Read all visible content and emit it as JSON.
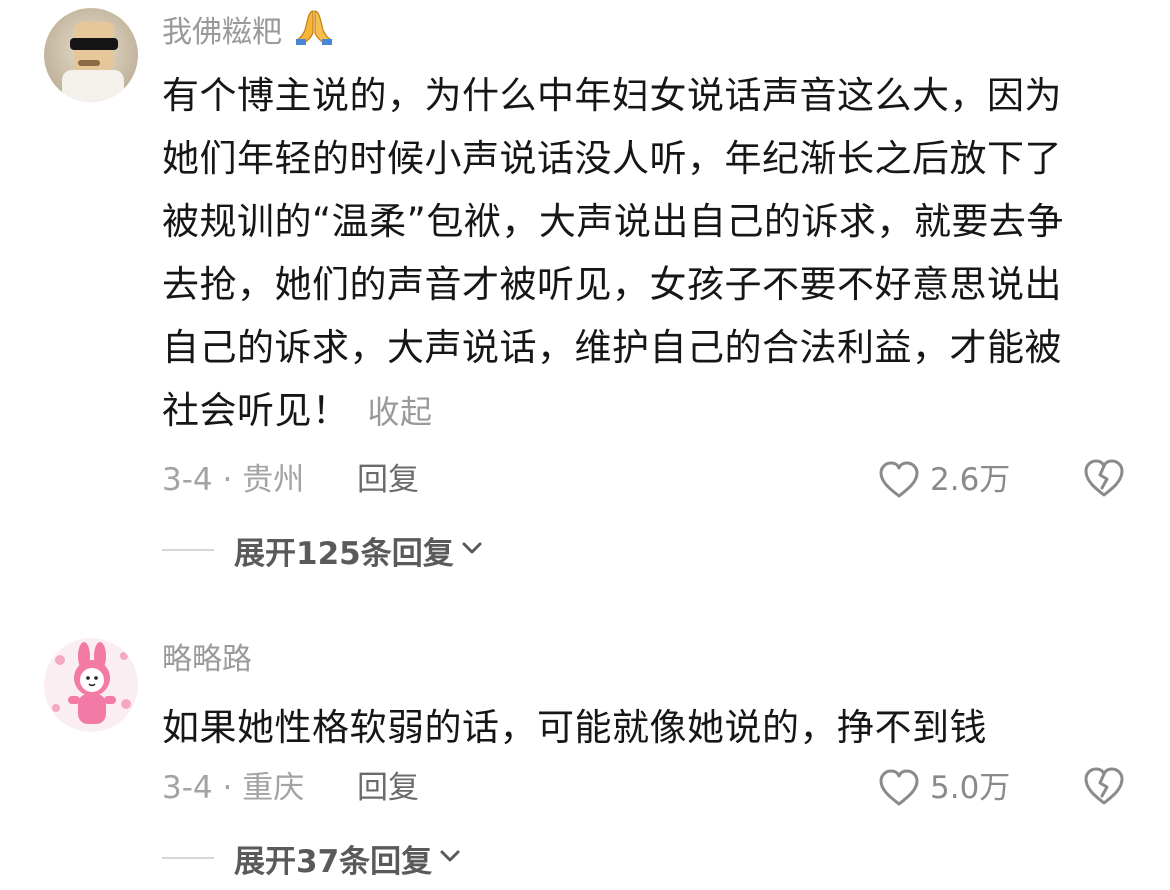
{
  "comments": [
    {
      "username": "我佛糍粑",
      "username_emoji": "folded-hands-emoji",
      "avatar": "cartoon-character-with-sunglasses",
      "lines": [
        "有个博主说的，为什么中年妇女说话声音这么大，因为",
        "她们年轻的时候小声说话没人听，年纪渐长之后放下了",
        "被规训的“温柔”包袱，大声说出自己的诉求，就要去争",
        "去抢，她们的声音才被听见，女孩子不要不好意思说出",
        "自己的诉求，大声说话，维护自己的合法利益，才能被",
        "社会听见！"
      ],
      "collapse_label": "收起",
      "meta": "3-4 · 贵州",
      "reply_label": "回复",
      "likes": "2.6万",
      "expand_label": "展开125条回复"
    },
    {
      "username": "略略路",
      "avatar": "pink-bunny-illustration",
      "lines": [
        "如果她性格软弱的话，可能就像她说的，挣不到钱"
      ],
      "meta": "3-4 · 重庆",
      "reply_label": "回复",
      "likes": "5.0万",
      "expand_label": "展开37条回复"
    }
  ],
  "colors": {
    "text": "#161616",
    "secondary": "#9a9a9a",
    "expand_text": "#5a5a5a",
    "icon_stroke": "#8a8a8a"
  }
}
